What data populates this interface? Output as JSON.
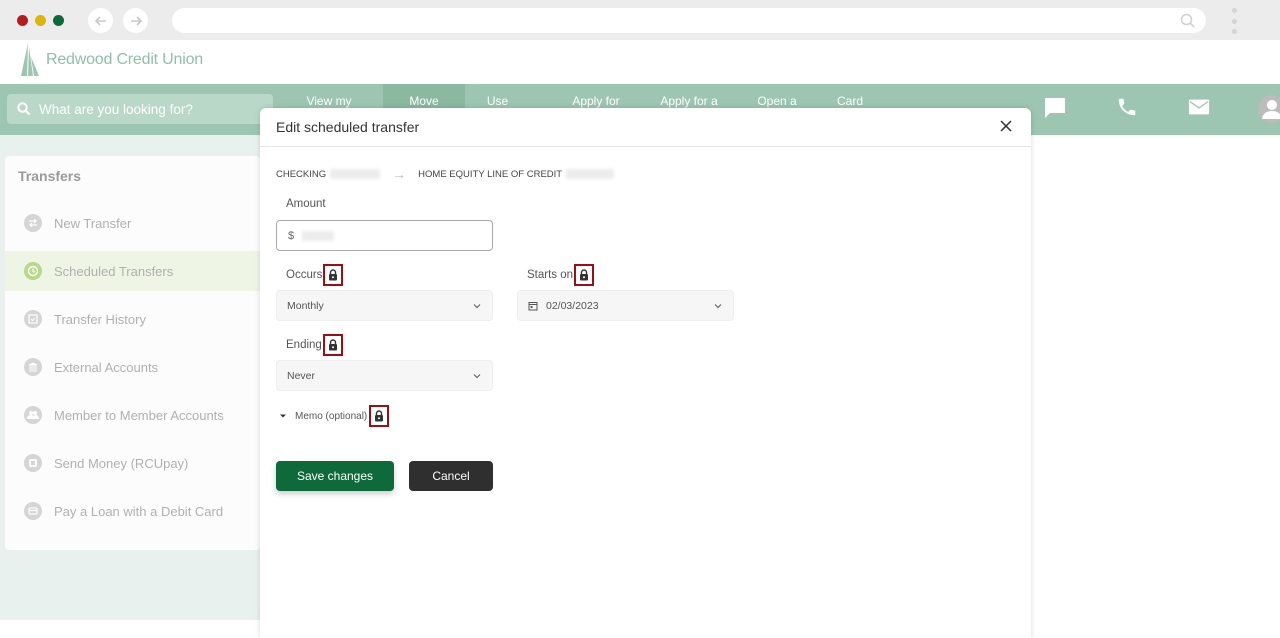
{
  "browser": {
    "traffic_lights": [
      "#b71c1c",
      "#e0b400",
      "#0b6b36"
    ]
  },
  "brand": {
    "name": "Redwood Credit Union",
    "accent": "#9cc6b1"
  },
  "navbar": {
    "search_placeholder": "What are you looking for?",
    "items": [
      {
        "label": "View my",
        "active": false
      },
      {
        "label": "Move",
        "active": true
      },
      {
        "label": "Use",
        "active": false
      },
      {
        "label": "Apply for",
        "active": false
      },
      {
        "label": "Apply for a",
        "active": false
      },
      {
        "label": "Open a",
        "active": false
      },
      {
        "label": "Card",
        "active": false
      }
    ],
    "icons": [
      "more-icon",
      "chat-icon",
      "phone-icon",
      "mail-icon",
      "profile-icon"
    ]
  },
  "sidebar": {
    "title": "Transfers",
    "items": [
      {
        "label": "New Transfer",
        "icon": "transfer-icon",
        "active": false
      },
      {
        "label": "Scheduled Transfers",
        "icon": "clock-icon",
        "active": true
      },
      {
        "label": "Transfer History",
        "icon": "history-icon",
        "active": false
      },
      {
        "label": "External Accounts",
        "icon": "bank-icon",
        "active": false
      },
      {
        "label": "Member to Member Accounts",
        "icon": "members-icon",
        "active": false
      },
      {
        "label": "Send Money (RCUpay)",
        "icon": "send-money-icon",
        "active": false
      },
      {
        "label": "Pay a Loan with a Debit Card",
        "icon": "card-icon",
        "active": false
      }
    ]
  },
  "modal": {
    "title": "Edit scheduled transfer",
    "from_account": "CHECKING",
    "to_account": "HOME EQUITY LINE OF CREDIT",
    "amount_label": "Amount",
    "currency_symbol": "$",
    "occurs_label": "Occurs",
    "occurs_value": "Monthly",
    "starts_label": "Starts on",
    "starts_value": "02/03/2023",
    "ending_label": "Ending",
    "ending_value": "Never",
    "memo_label": "Memo (optional)",
    "save_label": "Save changes",
    "cancel_label": "Cancel",
    "highlight_color": "#9b0f14",
    "save_color": "#0e6a3a"
  }
}
